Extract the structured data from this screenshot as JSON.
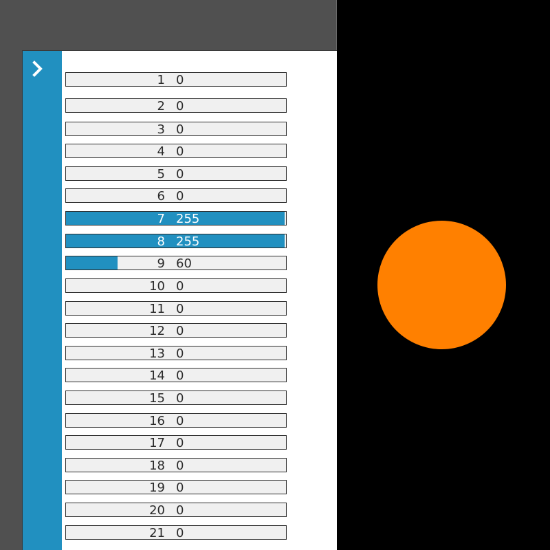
{
  "colors": {
    "accent": "#2190c0",
    "track": "#f0f0f0",
    "indicator": "#ff8000",
    "background": "#000000",
    "chrome": "#505050"
  },
  "panel": {
    "expand_icon": "chevron-right-icon"
  },
  "channels": [
    {
      "channel": "1",
      "value": "0",
      "level": 0
    },
    {
      "channel": "2",
      "value": "0",
      "level": 0
    },
    {
      "channel": "3",
      "value": "0",
      "level": 0
    },
    {
      "channel": "4",
      "value": "0",
      "level": 0
    },
    {
      "channel": "5",
      "value": "0",
      "level": 0
    },
    {
      "channel": "6",
      "value": "0",
      "level": 0
    },
    {
      "channel": "7",
      "value": "255",
      "level": 255
    },
    {
      "channel": "8",
      "value": "255",
      "level": 255
    },
    {
      "channel": "9",
      "value": "60",
      "level": 60
    },
    {
      "channel": "10",
      "value": "0",
      "level": 0
    },
    {
      "channel": "11",
      "value": "0",
      "level": 0
    },
    {
      "channel": "12",
      "value": "0",
      "level": 0
    },
    {
      "channel": "13",
      "value": "0",
      "level": 0
    },
    {
      "channel": "14",
      "value": "0",
      "level": 0
    },
    {
      "channel": "15",
      "value": "0",
      "level": 0
    },
    {
      "channel": "16",
      "value": "0",
      "level": 0
    },
    {
      "channel": "17",
      "value": "0",
      "level": 0
    },
    {
      "channel": "18",
      "value": "0",
      "level": 0
    },
    {
      "channel": "19",
      "value": "0",
      "level": 0
    },
    {
      "channel": "20",
      "value": "0",
      "level": 0
    },
    {
      "channel": "21",
      "value": "0",
      "level": 0
    }
  ]
}
